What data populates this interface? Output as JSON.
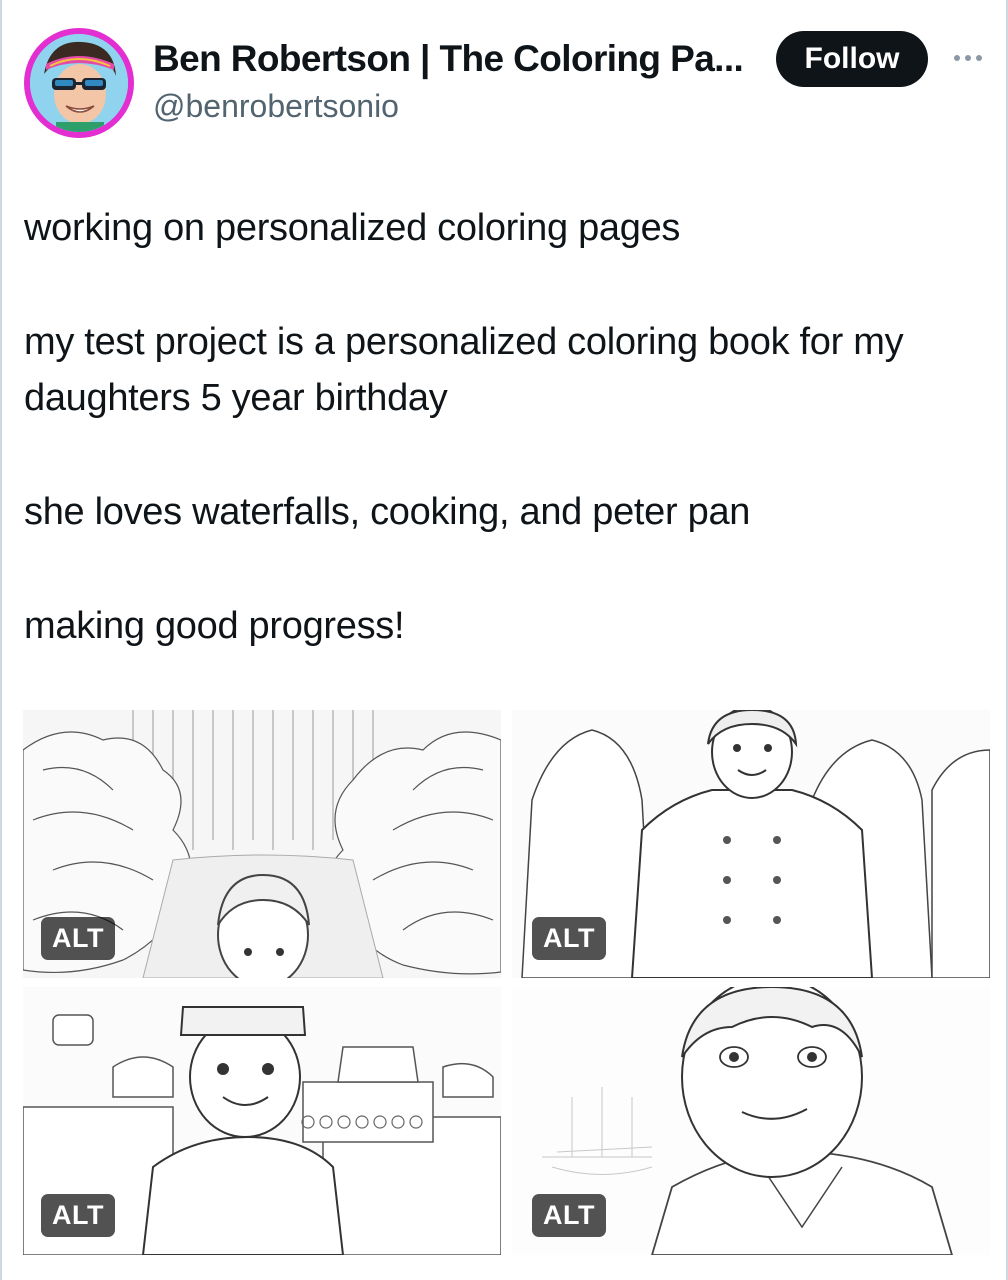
{
  "author": {
    "display_name": "Ben Robertson | The Coloring Pa...",
    "handle": "@benrobertsonio",
    "avatar_ring_color": "#e32fd1"
  },
  "actions": {
    "follow_label": "Follow",
    "more_icon": "more-horizontal-icon"
  },
  "tweet": {
    "paragraphs": [
      "working on personalized coloring pages",
      "my test project is a personalized coloring book for my daughters 5 year birthday",
      "she loves waterfalls, cooking, and peter pan",
      "making good progress!"
    ]
  },
  "media": {
    "images": [
      {
        "alt_label": "ALT"
      },
      {
        "alt_label": "ALT"
      },
      {
        "alt_label": "ALT"
      },
      {
        "alt_label": "ALT"
      }
    ]
  }
}
